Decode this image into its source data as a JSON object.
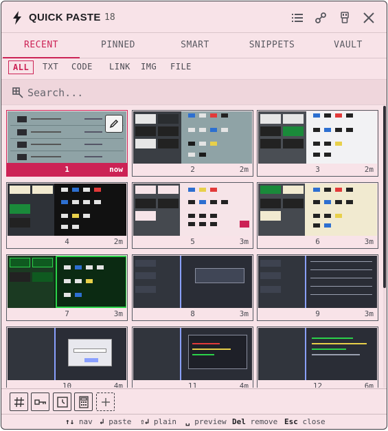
{
  "app": {
    "title": "QUICK PASTE",
    "count": "18"
  },
  "header_icons": [
    "list-icon",
    "link-icon",
    "usb-icon",
    "close-icon"
  ],
  "tabs": [
    {
      "label": "RECENT",
      "active": true
    },
    {
      "label": "PINNED"
    },
    {
      "label": "SMART"
    },
    {
      "label": "SNIPPETS"
    },
    {
      "label": "VAULT"
    }
  ],
  "filters": [
    {
      "label": "ALL",
      "active": true
    },
    {
      "label": "TXT"
    },
    {
      "label": "CODE"
    },
    {
      "label": "LINK"
    },
    {
      "label": "IMG"
    },
    {
      "label": "FILE"
    }
  ],
  "search": {
    "placeholder": "Search..."
  },
  "items": [
    {
      "num": "1",
      "time": "now",
      "selected": true,
      "style": "table"
    },
    {
      "num": "2",
      "time": "2m",
      "style": "slate"
    },
    {
      "num": "3",
      "time": "2m",
      "style": "white"
    },
    {
      "num": "4",
      "time": "2m",
      "style": "dark-cream"
    },
    {
      "num": "5",
      "time": "3m",
      "style": "pink"
    },
    {
      "num": "6",
      "time": "3m",
      "style": "cream"
    },
    {
      "num": "7",
      "time": "3m",
      "style": "green"
    },
    {
      "num": "8",
      "time": "3m",
      "style": "navy"
    },
    {
      "num": "9",
      "time": "3m",
      "style": "navy-list"
    },
    {
      "num": "10",
      "time": "4m",
      "style": "dialog"
    },
    {
      "num": "11",
      "time": "4m",
      "style": "editor"
    },
    {
      "num": "12",
      "time": "6m",
      "style": "code"
    }
  ],
  "toolbar": [
    "hash-icon",
    "key-icon",
    "clock-icon",
    "calculator-icon",
    "plus-icon"
  ],
  "hints": {
    "nav_key": "↑↓",
    "nav": "nav",
    "paste_key": "↲",
    "paste": "paste",
    "plain_key": "⇧↲",
    "plain": "plain",
    "preview_key": "␣",
    "preview": "preview",
    "remove_key": "Del",
    "remove": "remove",
    "close_key": "Esc",
    "close": "close"
  },
  "colors": {
    "accent": "#cc2255",
    "background": "#f8e3e8"
  }
}
